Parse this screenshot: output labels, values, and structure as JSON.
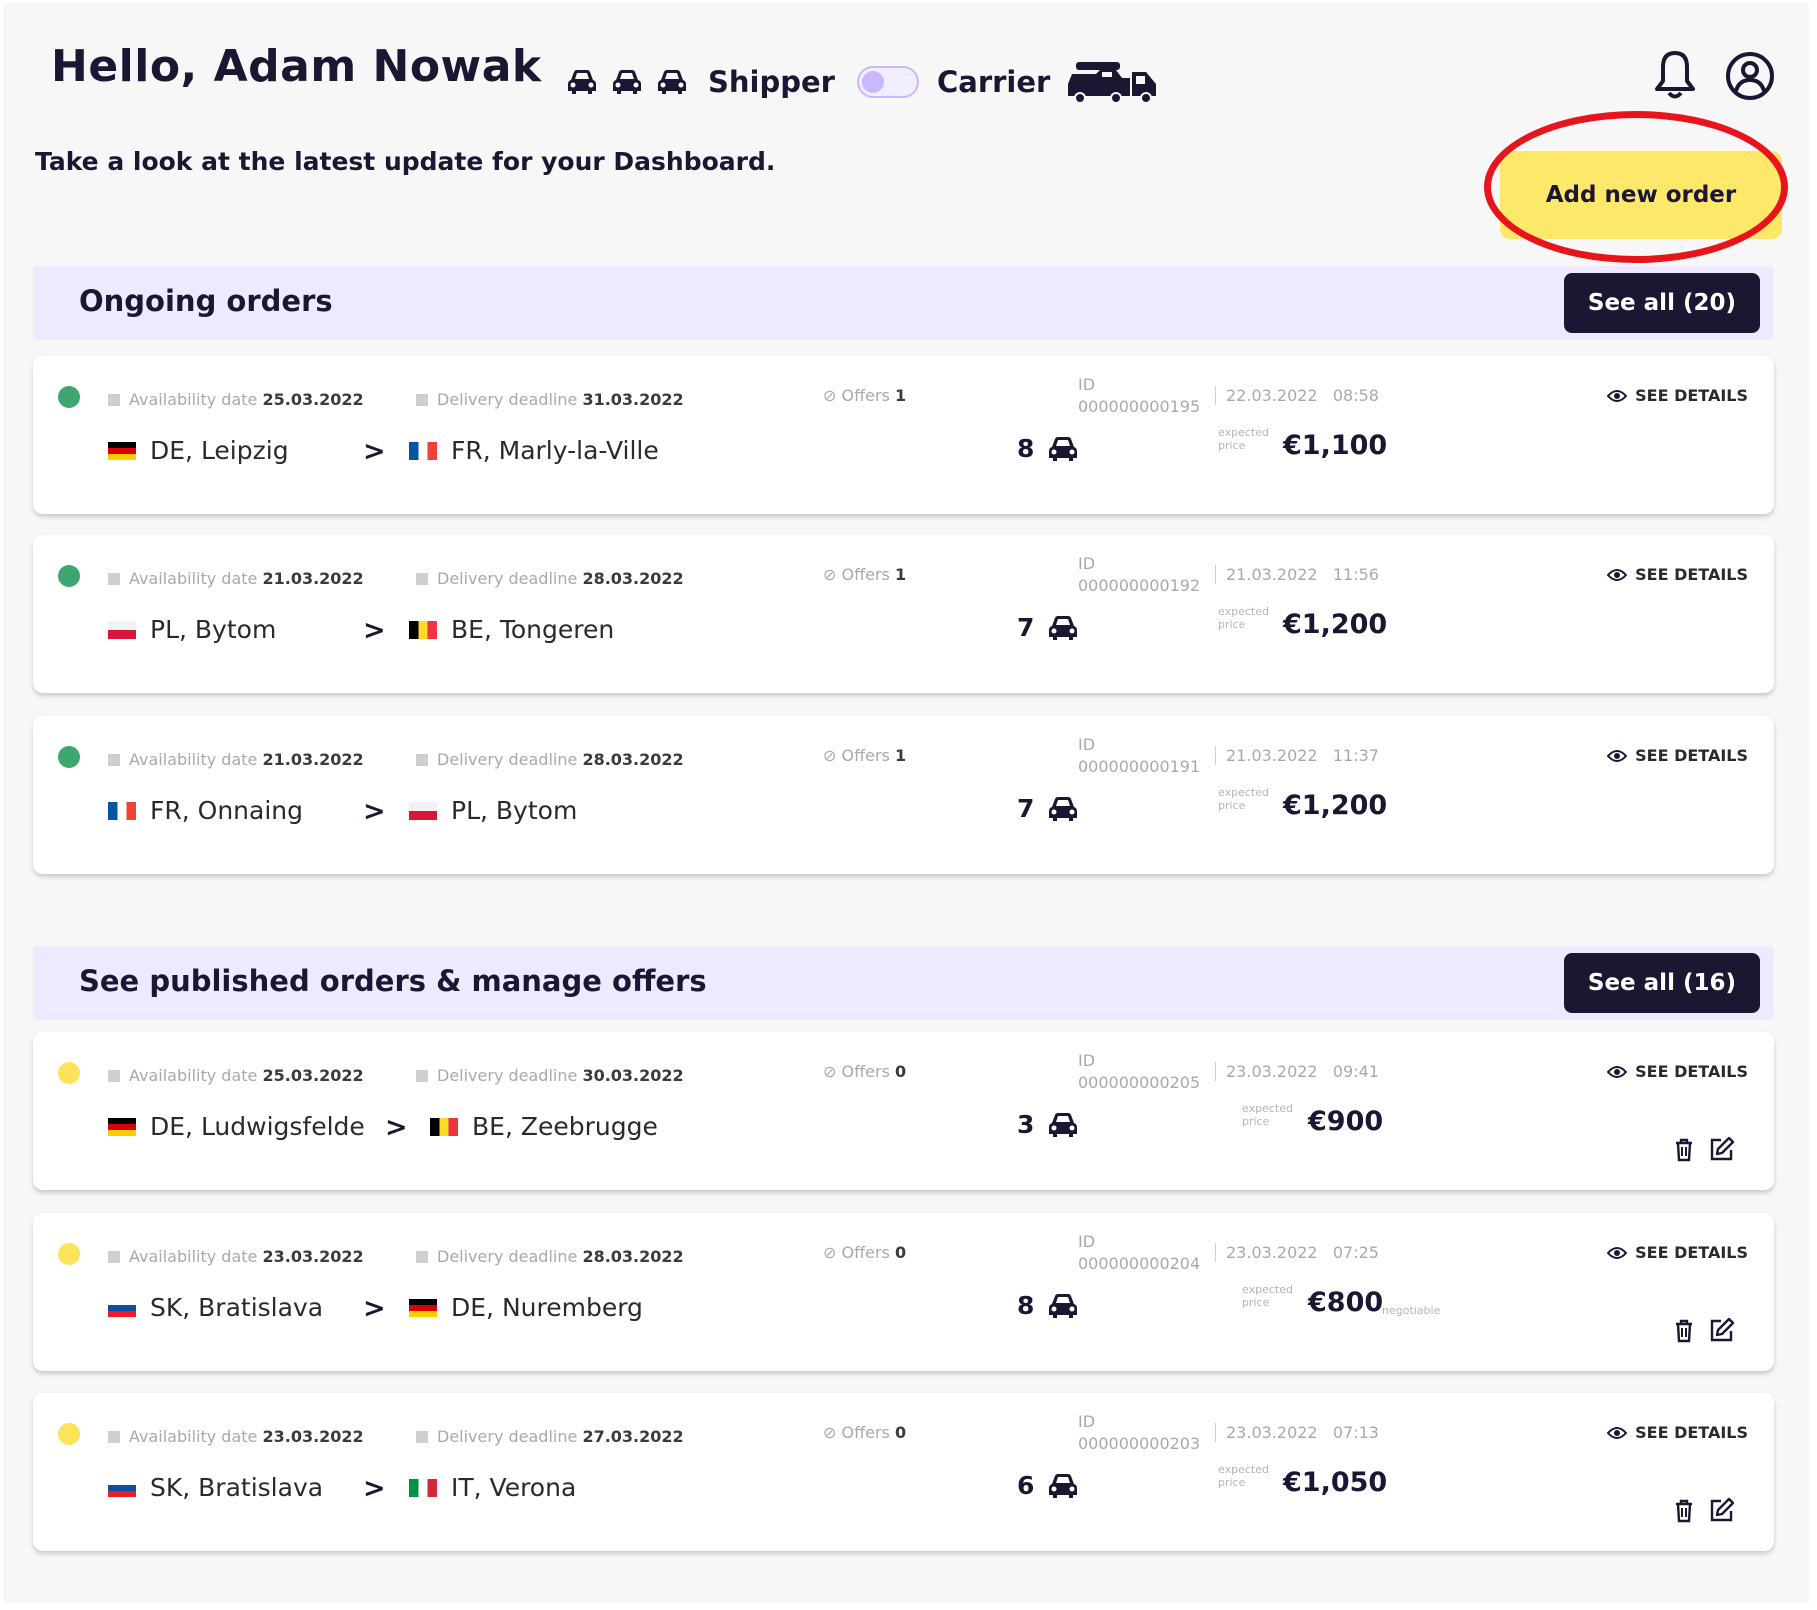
{
  "header": {
    "greeting": "Hello, Adam Nowak",
    "subtitle": "Take a look at the latest update for your Dashboard.",
    "mode_shipper": "Shipper",
    "mode_carrier": "Carrier",
    "add_order": "Add new order"
  },
  "colors": {
    "accent": "#1c1633",
    "section_bg": "#efe9ff",
    "button_yellow": "#fde86a",
    "highlight_red": "#e8141c",
    "status_green": "#3ea66f",
    "status_yellow": "#fbe35a"
  },
  "labels": {
    "availability": "Availability date",
    "deadline": "Delivery deadline",
    "offers": "Offers",
    "id": "ID",
    "expected": "expected",
    "price": "price",
    "see_details": "SEE DETAILS",
    "negotiable": "negotiable"
  },
  "ongoing": {
    "title": "Ongoing orders",
    "see_all": "See all (20)",
    "orders": [
      {
        "availability": "25.03.2022",
        "deadline": "31.03.2022",
        "from": "DE, Leipzig",
        "to": "FR, Marly-la-Ville",
        "offers": "1",
        "vehicles": "8",
        "id": "000000000195",
        "date": "22.03.2022",
        "time": "08:58",
        "price": "€1,100"
      },
      {
        "availability": "21.03.2022",
        "deadline": "28.03.2022",
        "from": "PL, Bytom",
        "to": "BE, Tongeren",
        "offers": "1",
        "vehicles": "7",
        "id": "000000000192",
        "date": "21.03.2022",
        "time": "11:56",
        "price": "€1,200"
      },
      {
        "availability": "21.03.2022",
        "deadline": "28.03.2022",
        "from": "FR, Onnaing",
        "to": "PL, Bytom",
        "offers": "1",
        "vehicles": "7",
        "id": "000000000191",
        "date": "21.03.2022",
        "time": "11:37",
        "price": "€1,200"
      }
    ]
  },
  "published": {
    "title": "See published orders & manage offers",
    "see_all": "See all (16)",
    "orders": [
      {
        "availability": "25.03.2022",
        "deadline": "30.03.2022",
        "from": "DE, Ludwigsfelde",
        "to": "BE, Zeebrugge",
        "offers": "0",
        "vehicles": "3",
        "id": "000000000205",
        "date": "23.03.2022",
        "time": "09:41",
        "price": "€900"
      },
      {
        "availability": "23.03.2022",
        "deadline": "28.03.2022",
        "from": "SK, Bratislava",
        "to": "DE, Nuremberg",
        "offers": "0",
        "vehicles": "8",
        "id": "000000000204",
        "date": "23.03.2022",
        "time": "07:25",
        "price": "€800"
      },
      {
        "availability": "23.03.2022",
        "deadline": "27.03.2022",
        "from": "SK, Bratislava",
        "to": "IT, Verona",
        "offers": "0",
        "vehicles": "6",
        "id": "000000000203",
        "date": "23.03.2022",
        "time": "07:13",
        "price": "€1,050"
      }
    ]
  }
}
